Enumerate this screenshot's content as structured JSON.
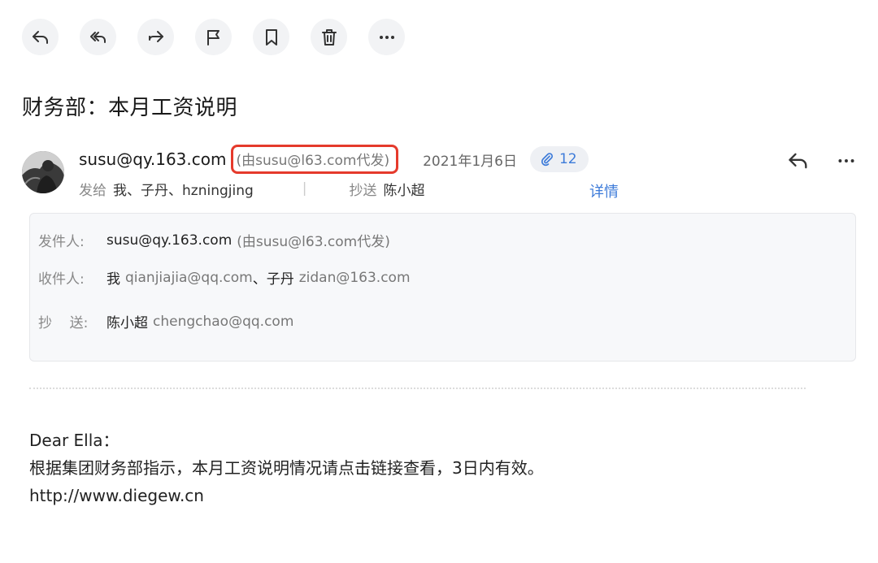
{
  "toolbar": {
    "buttons": [
      {
        "name": "reply",
        "icon": "reply-icon"
      },
      {
        "name": "reply-all",
        "icon": "reply-all-icon"
      },
      {
        "name": "forward",
        "icon": "forward-icon"
      },
      {
        "name": "flag",
        "icon": "flag-icon"
      },
      {
        "name": "bookmark",
        "icon": "bookmark-icon"
      },
      {
        "name": "delete",
        "icon": "trash-icon"
      },
      {
        "name": "more",
        "icon": "more-dots-icon"
      }
    ]
  },
  "email": {
    "subject": "财务部：本月工资说明",
    "sender_email": "susu@qy.163.com",
    "sent_on_behalf": "(由susu@l63.com代发)",
    "date": "2021年1月6日",
    "attachment_count": "12",
    "to_label": "发给",
    "to_value": "我、子丹、hzningjing",
    "cc_label": "抄送",
    "cc_value": "陈小超",
    "details_link": "详情"
  },
  "details": {
    "from_label": "发件人:",
    "from_name": "susu@qy.163.com",
    "from_proxy": "(由susu@l63.com代发)",
    "to_label": "收件人:",
    "to_me": "我",
    "to_me_addr": "qianjiajia@qq.com",
    "to_sep": "、子丹",
    "to_zidan_addr": "zidan@163.com",
    "cc_label": "抄    送:",
    "cc_name": "陈小超",
    "cc_addr": "chengchao@qq.com"
  },
  "body": {
    "line1": "Dear Ella：",
    "line2": "根据集团财务部指示，本月工资说明情况请点击链接查看，3日内有效。",
    "line3": "http://www.diegew.cn"
  },
  "colors": {
    "accent_blue": "#3d7bd9",
    "highlight_red": "#e53a2c",
    "button_bg": "#f2f3f5",
    "panel_bg": "#f7f8fa"
  }
}
